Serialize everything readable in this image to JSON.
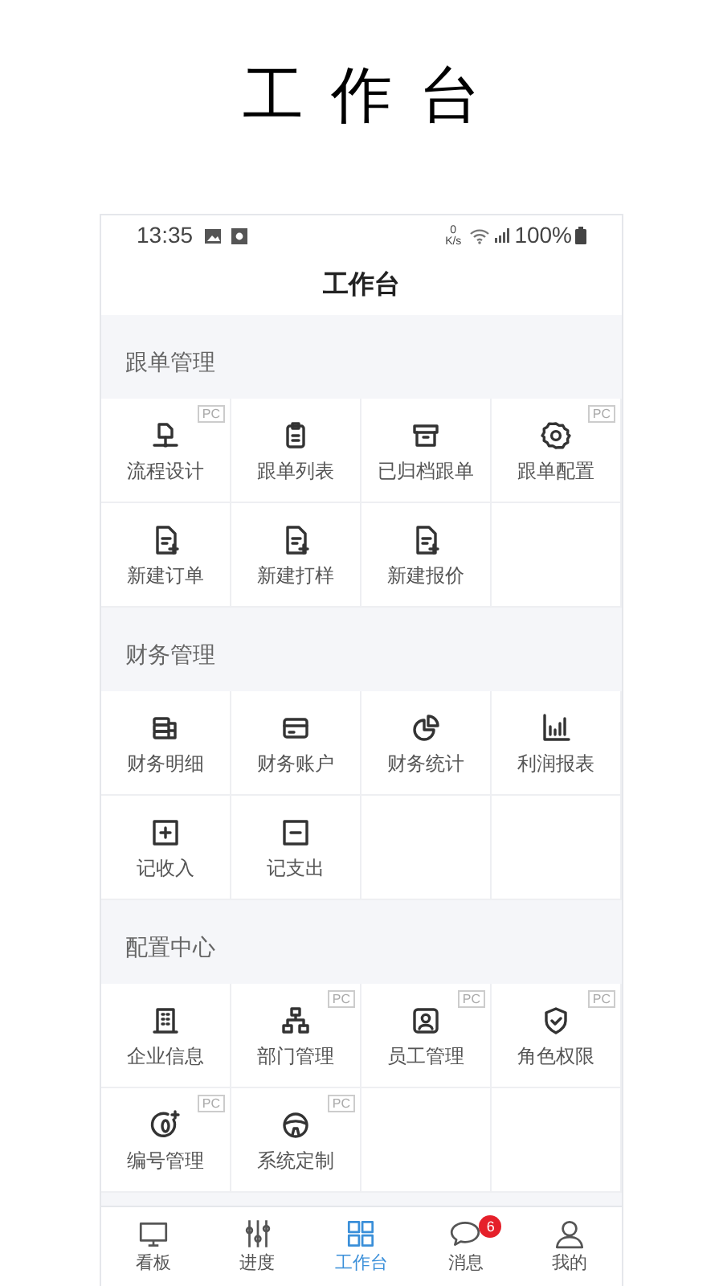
{
  "headline": "工作台",
  "status_bar": {
    "time": "13:35",
    "net_speed_value": "0",
    "net_speed_unit": "K/s",
    "battery": "100%"
  },
  "header": {
    "title": "工作台"
  },
  "sections": [
    {
      "title": "跟单管理",
      "items": [
        {
          "label": "流程设计",
          "badge": "PC"
        },
        {
          "label": "跟单列表"
        },
        {
          "label": "已归档跟单"
        },
        {
          "label": "跟单配置",
          "badge": "PC"
        },
        {
          "label": "新建订单"
        },
        {
          "label": "新建打样"
        },
        {
          "label": "新建报价"
        }
      ]
    },
    {
      "title": "财务管理",
      "items": [
        {
          "label": "财务明细"
        },
        {
          "label": "财务账户"
        },
        {
          "label": "财务统计"
        },
        {
          "label": "利润报表"
        },
        {
          "label": "记收入"
        },
        {
          "label": "记支出"
        }
      ]
    },
    {
      "title": "配置中心",
      "items": [
        {
          "label": "企业信息"
        },
        {
          "label": "部门管理",
          "badge": "PC"
        },
        {
          "label": "员工管理",
          "badge": "PC"
        },
        {
          "label": "角色权限",
          "badge": "PC"
        },
        {
          "label": "编号管理",
          "badge": "PC"
        },
        {
          "label": "系统定制",
          "badge": "PC"
        }
      ]
    }
  ],
  "tab_bar": [
    {
      "label": "看板",
      "selected": false
    },
    {
      "label": "进度",
      "selected": false
    },
    {
      "label": "工作台",
      "selected": true
    },
    {
      "label": "消息",
      "selected": false,
      "badge": "6"
    },
    {
      "label": "我的",
      "selected": false
    }
  ]
}
